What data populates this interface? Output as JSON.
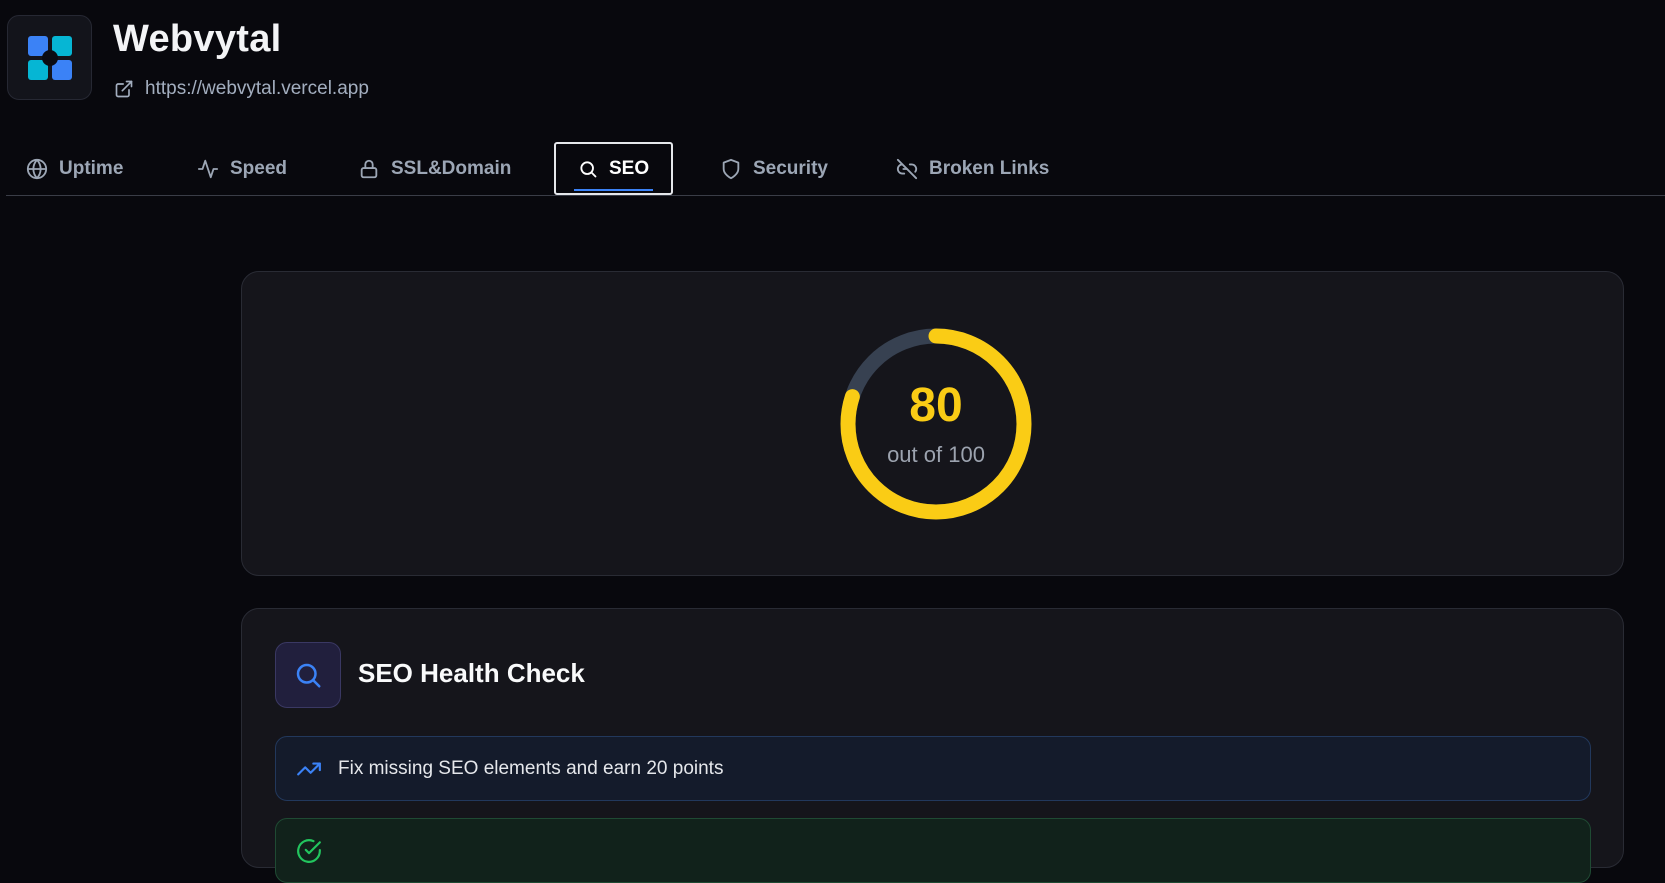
{
  "app": {
    "title": "Webvytal",
    "url": "https://webvytal.vercel.app",
    "logo_icon": "grid-logo-icon",
    "external_link_icon": "external-link-icon"
  },
  "tabs": [
    {
      "label": "Uptime",
      "icon": "globe-icon",
      "active": false
    },
    {
      "label": "Speed",
      "icon": "activity-icon",
      "active": false
    },
    {
      "label": "SSL&Domain",
      "icon": "lock-icon",
      "active": false
    },
    {
      "label": "SEO",
      "icon": "search-icon",
      "active": true
    },
    {
      "label": "Security",
      "icon": "shield-icon",
      "active": false
    },
    {
      "label": "Broken Links",
      "icon": "link-off-icon",
      "active": false
    }
  ],
  "score": {
    "value": "80",
    "max": 100,
    "caption": "out of 100",
    "fraction": 0.8,
    "color": "#facc15",
    "track_color": "#374151"
  },
  "health_check": {
    "title": "SEO Health Check",
    "icon": "search-icon",
    "tip": {
      "text": "Fix missing SEO elements and earn 20 points",
      "icon": "trending-up-icon"
    },
    "ok_icon": "check-circle-icon"
  },
  "colors": {
    "accent_blue": "#3b82f6",
    "background": "#08080d",
    "card": "#15151b"
  }
}
